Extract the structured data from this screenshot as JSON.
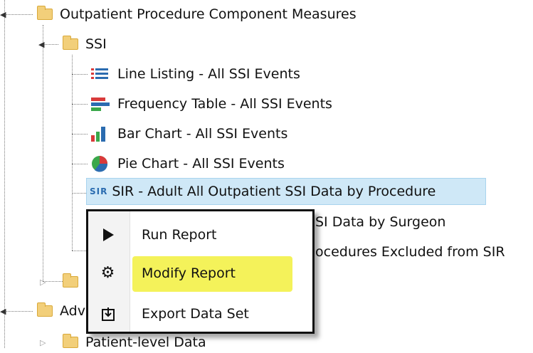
{
  "tree": {
    "opcm_label": "Outpatient Procedure Component Measures",
    "ssi_label": "SSI",
    "items": [
      {
        "label": "Line Listing - All SSI Events",
        "icon": "line-listing-icon"
      },
      {
        "label": "Frequency Table - All SSI Events",
        "icon": "frequency-table-icon"
      },
      {
        "label": "Bar Chart - All SSI Events",
        "icon": "bar-chart-icon"
      },
      {
        "label": "Pie Chart - All SSI Events",
        "icon": "pie-chart-icon"
      },
      {
        "label": "SIR - Adult All Outpatient SSI Data by Procedure",
        "icon": "sir-icon",
        "icon_text": "SIR"
      },
      {
        "label": "SI Data by Surgeon"
      },
      {
        "label": "ocedures Excluded from SIR"
      }
    ],
    "adv_label": "Adv",
    "patient_level_label": "Patient-level Data"
  },
  "context_menu": {
    "items": [
      {
        "label": "Run Report",
        "icon": "play-icon"
      },
      {
        "label": "Modify Report",
        "icon": "gear-icon"
      },
      {
        "label": "Export Data Set",
        "icon": "export-icon"
      }
    ],
    "highlight_color": "#f4f25a"
  },
  "colors": {
    "selection_bg": "#cfe8f7",
    "folder": "#f2cf7a"
  }
}
